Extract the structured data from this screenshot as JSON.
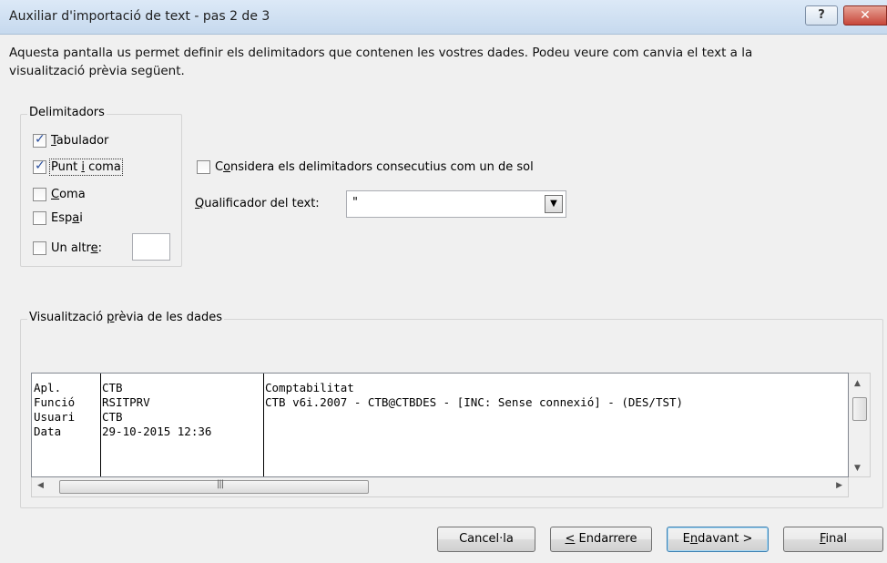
{
  "window": {
    "title": "Auxiliar d'importació de text - pas 2 de 3",
    "help_label": "?",
    "close_label": "✕"
  },
  "intro": {
    "line1": "Aquesta pantalla us permet definir els delimitadors que contenen les vostres dades. Podeu veure com canvia el text a la",
    "line2": "visualització prèvia següent."
  },
  "delimiters": {
    "legend": "Delimitadors",
    "tab": {
      "pre": "",
      "accel": "T",
      "post": "abulador",
      "checked": true
    },
    "semicolon": {
      "pre": "Punt ",
      "accel": "i",
      "post": " coma",
      "checked": true
    },
    "comma": {
      "pre": "",
      "accel": "C",
      "post": "oma",
      "checked": false
    },
    "space": {
      "pre": "Esp",
      "accel": "a",
      "post": "i",
      "checked": false
    },
    "other": {
      "pre": "Un altr",
      "accel": "e",
      "post": ":",
      "checked": false,
      "value": ""
    }
  },
  "consecutive": {
    "pre": "C",
    "accel": "o",
    "post": "nsidera els delimitadors consecutius com un de sol",
    "checked": false
  },
  "qualifier": {
    "label_pre": "",
    "label_accel": "Q",
    "label_post": "ualificador del text:",
    "value": "\""
  },
  "preview": {
    "legend_pre": "Visualització ",
    "legend_accel": "p",
    "legend_post": "rèvia de les dades",
    "rows": [
      [
        "Apl.",
        "CTB",
        "Comptabilitat"
      ],
      [
        "Funció",
        "RSITPRV",
        "CTB v6i.2007 - CTB@CTBDES - [INC: Sense connexió] - (DES/TST)"
      ],
      [
        "Usuari",
        "CTB",
        ""
      ],
      [
        "Data",
        "29-10-2015 12:36",
        ""
      ]
    ]
  },
  "buttons": {
    "cancel": {
      "pre": "Cancel·la",
      "accel": "",
      "post": ""
    },
    "back": {
      "pre": "",
      "accel": "<",
      "post": " Endarrere"
    },
    "next": {
      "pre": "E",
      "accel": "n",
      "post": "davant >"
    },
    "finish": {
      "pre": "",
      "accel": "F",
      "post": "inal"
    }
  },
  "colors": {
    "titlebar": "#c6d9ee",
    "close": "#c7473a",
    "default_button_border": "#3c7fb1"
  }
}
